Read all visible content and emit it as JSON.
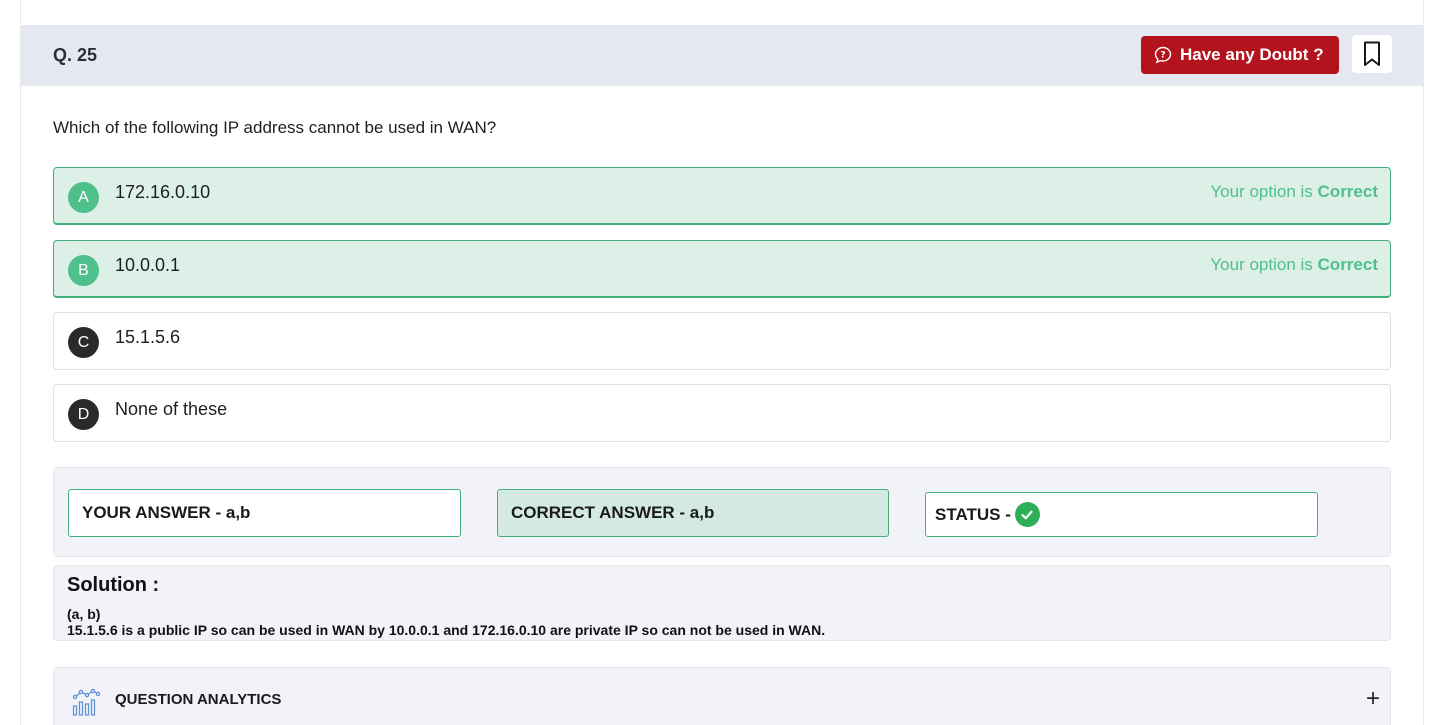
{
  "question_header": {
    "number": "Q. 25",
    "doubt_button": "Have any Doubt ?",
    "icons": [
      "doubt-icon",
      "bookmark-icon"
    ]
  },
  "question": {
    "text": "Which of the following IP address cannot be used in WAN?"
  },
  "options": [
    {
      "letter": "A",
      "text": "172.16.0.10",
      "status_prefix": "Your option is ",
      "status_value": "Correct",
      "state": "correct"
    },
    {
      "letter": "B",
      "text": "10.0.0.1",
      "status_prefix": "Your option is ",
      "status_value": "Correct",
      "state": "correct"
    },
    {
      "letter": "C",
      "text": "15.1.5.6",
      "state": "plain"
    },
    {
      "letter": "D",
      "text": "None of these",
      "state": "plain"
    }
  ],
  "answers": {
    "your_answer": "YOUR ANSWER - a,b",
    "correct_answer": "CORRECT ANSWER - a,b",
    "status_label": "STATUS -",
    "status_icon": "check-circle-icon"
  },
  "solution": {
    "title": "Solution :",
    "line1": "(a, b)",
    "line2": "15.1.5.6 is a public IP so can be used in WAN by 10.0.0.1 and 172.16.0.10 are private IP so can not be used in WAN."
  },
  "analytics": {
    "label": "QUESTION ANALYTICS",
    "toggle": "+"
  },
  "colors": {
    "header_bg": "#e5e8f0",
    "doubt_button_bg": "#b3131d",
    "correct_green": "#4fbf8b",
    "correct_bg": "#dcf0e8",
    "status_check": "#2fae58"
  }
}
